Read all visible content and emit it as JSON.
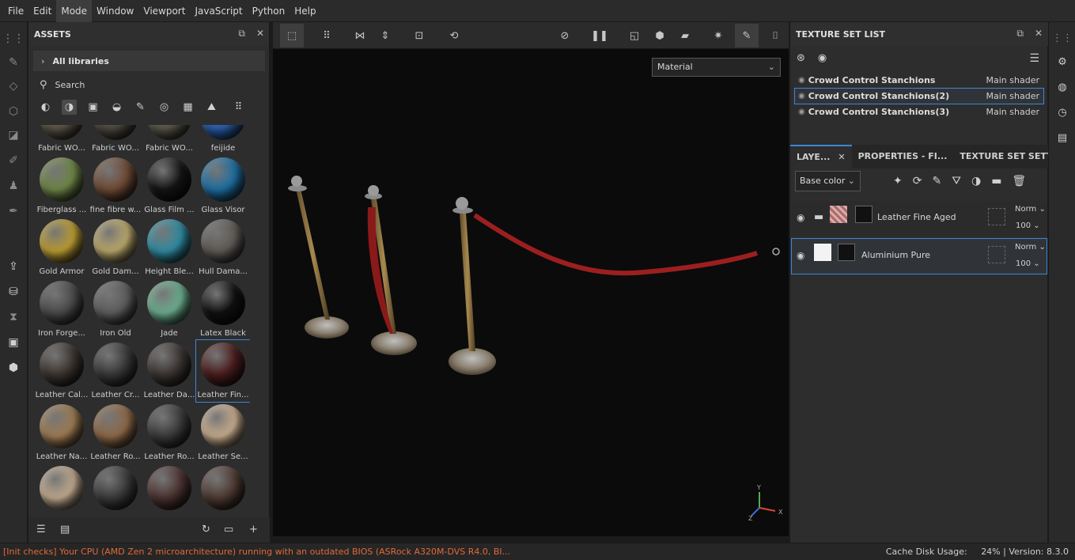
{
  "menu": [
    "File",
    "Edit",
    "Mode",
    "Window",
    "Viewport",
    "JavaScript",
    "Python",
    "Help"
  ],
  "menu_active": "Mode",
  "assets": {
    "title": "ASSETS",
    "libraries": "All libraries",
    "search_placeholder": "Search",
    "items": [
      {
        "label": "Fabric WO...",
        "color": "#5b5446"
      },
      {
        "label": "Fabric WO...",
        "color": "#4e4a40"
      },
      {
        "label": "Fabric WO...",
        "color": "#5a5649"
      },
      {
        "label": "feijide",
        "color": "#2a5fae"
      },
      {
        "label": "Fiberglass ...",
        "color": "#6d8446"
      },
      {
        "label": "fine fibre w...",
        "color": "#6e4a35"
      },
      {
        "label": "Glass Film ...",
        "color": "#141414"
      },
      {
        "label": "Glass Visor",
        "color": "#1e6ea0"
      },
      {
        "label": "Gold Armor",
        "color": "#b89a32"
      },
      {
        "label": "Gold Dam...",
        "color": "#b8a66a"
      },
      {
        "label": "Height Ble...",
        "color": "#2f8aa0"
      },
      {
        "label": "Hull Dama...",
        "color": "#5e5a55"
      },
      {
        "label": "Iron Forge...",
        "color": "#4a4a4a"
      },
      {
        "label": "Iron Old",
        "color": "#5c5c5c"
      },
      {
        "label": "Jade",
        "color": "#6aab8c"
      },
      {
        "label": "Latex Black",
        "color": "#101010"
      },
      {
        "label": "Leather Cal...",
        "color": "#3b342e"
      },
      {
        "label": "Leather Cr...",
        "color": "#383838"
      },
      {
        "label": "Leather Da...",
        "color": "#3a3431"
      },
      {
        "label": "Leather Fin...",
        "color": "#4a1c1c"
      },
      {
        "label": "Leather Na...",
        "color": "#9c7a52"
      },
      {
        "label": "Leather Ro...",
        "color": "#8c6848"
      },
      {
        "label": "Leather Ro...",
        "color": "#3a3a3a"
      },
      {
        "label": "Leather Se...",
        "color": "#c4aa8c"
      },
      {
        "label": "",
        "color": "#bda78c"
      },
      {
        "label": "",
        "color": "#3a3a3a"
      },
      {
        "label": "",
        "color": "#4a3230"
      },
      {
        "label": "",
        "color": "#4e3a32"
      }
    ],
    "selected_index": 19
  },
  "viewport": {
    "material_mode": "Material"
  },
  "texture_set_list": {
    "title": "TEXTURE SET LIST",
    "sets": [
      {
        "name": "Crowd Control Stanchions",
        "shader": "Main shader"
      },
      {
        "name": "Crowd Control Stanchions(2)",
        "shader": "Main shader"
      },
      {
        "name": "Crowd Control Stanchions(3)",
        "shader": "Main shader"
      }
    ],
    "selected_index": 1
  },
  "layers_panel": {
    "tabs": [
      "LAYE...",
      "PROPERTIES - FI...",
      "TEXTURE SET SETTIN..."
    ],
    "channel": "Base color",
    "layers": [
      {
        "name": "Leather Fine Aged",
        "blend": "Norm",
        "opacity": "100"
      },
      {
        "name": "Aluminium Pure",
        "blend": "Norm",
        "opacity": "100"
      }
    ]
  },
  "status": {
    "message": "[Init checks] Your CPU (AMD Zen 2 microarchitecture) running with an outdated BIOS (ASRock A320M-DVS R4.0, BI...",
    "cache_label": "Cache Disk Usage:",
    "cache_value": "24%",
    "version": "Version: 8.3.0"
  },
  "colors": {
    "accent": "#3d86d6",
    "warning": "#e06a3a"
  }
}
